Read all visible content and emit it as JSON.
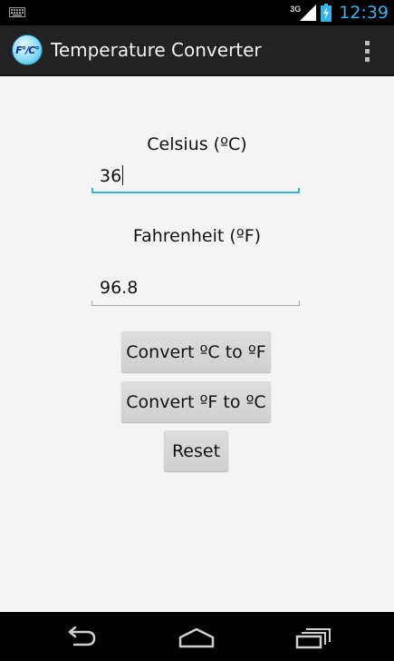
{
  "status_bar": {
    "network_type": "3G",
    "time": "12:39",
    "icons": [
      "keyboard-icon",
      "signal-icon",
      "battery-charging-icon"
    ]
  },
  "action_bar": {
    "app_icon_text": "F°/C°",
    "title": "Temperature Converter",
    "overflow_icon": "overflow-menu-icon"
  },
  "form": {
    "celsius_label": "Celsius (ºC)",
    "celsius_value": "36",
    "fahrenheit_label": "Fahrenheit (ºF)",
    "fahrenheit_value": "96.8"
  },
  "buttons": {
    "c_to_f": "Convert ºC to ºF",
    "f_to_c": "Convert ºF to ºC",
    "reset": "Reset"
  },
  "nav_bar": {
    "icons": [
      "back-icon",
      "home-icon",
      "recent-apps-icon"
    ]
  },
  "colors": {
    "accent": "#33b5e5",
    "action_bar": "#222222",
    "background": "#f4f4f4",
    "button": "#d6d6d6"
  }
}
